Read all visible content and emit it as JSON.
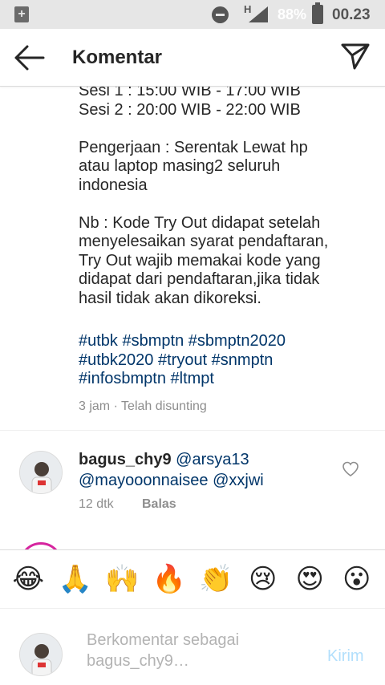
{
  "status_bar": {
    "battery": "88%",
    "time": "00.23",
    "network": "H"
  },
  "header": {
    "title": "Komentar"
  },
  "caption": {
    "lines": [
      "Sesi 1 : 15:00 WIB - 17:00 WIB",
      "Sesi 2 : 20:00 WIB - 22:00 WIB",
      "",
      "Pengerjaan : Serentak Lewat hp",
      "atau laptop masing2 seluruh",
      "indonesia",
      "",
      "Nb : Kode Try Out didapat setelah",
      "menyelesaikan syarat pendaftaran,",
      "Try Out wajib memakai kode yang",
      "didapat dari pendaftaran,jika tidak",
      "hasil tidak akan dikoreksi."
    ],
    "hashtags": [
      "#utbk #sbmptn #sbmptn2020",
      "#utbk2020 #tryout #snmptn",
      "#infosbmptn #ltmpt"
    ],
    "meta": "3 jam · Telah disunting"
  },
  "comment": {
    "username": "bagus_chy9",
    "mention1": "@arsya13",
    "mention2": "@mayooonnaisee",
    "mention3": "@xxjwi",
    "time": "12 dtk",
    "reply_label": "Balas"
  },
  "emojis": [
    "😂",
    "🙏",
    "🙌",
    "🔥",
    "👏",
    "😢",
    "😍",
    "😮"
  ],
  "input": {
    "placeholder": "Berkomentar sebagai bagus_chy9…",
    "post_label": "Kirim"
  }
}
